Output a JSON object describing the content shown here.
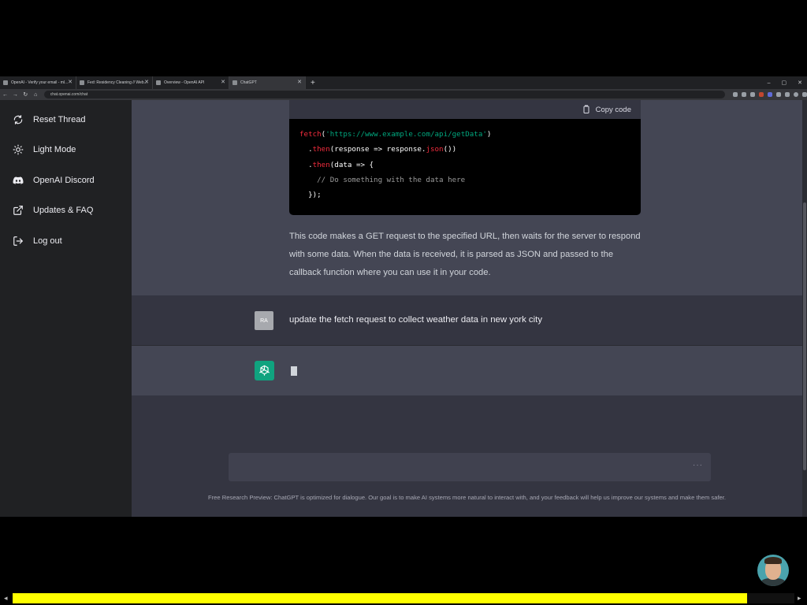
{
  "browser": {
    "tabs": [
      {
        "label": "OpenAI - Verify your email - ml..."
      },
      {
        "label": "Fed: Residency Cleaning // Web..."
      },
      {
        "label": "Overview - OpenAI API"
      },
      {
        "label": "ChatGPT"
      }
    ],
    "new_tab": "+",
    "url": "chat.openai.com/chat",
    "window_controls": {
      "minimize": "–",
      "maximize": "▢",
      "close": "✕"
    }
  },
  "sidebar": {
    "items": [
      {
        "label": "Reset Thread",
        "icon": "refresh-icon"
      },
      {
        "label": "Light Mode",
        "icon": "sun-icon"
      },
      {
        "label": "OpenAI Discord",
        "icon": "discord-icon"
      },
      {
        "label": "Updates & FAQ",
        "icon": "external-link-icon"
      },
      {
        "label": "Log out",
        "icon": "logout-icon"
      }
    ]
  },
  "conversation": {
    "code": {
      "copy_label": "Copy code",
      "lines": {
        "l1_fn": "fetch",
        "l1_open": "(",
        "l1_str": "'https://www.example.com/api/getData'",
        "l1_close": ")",
        "l2_dot": "  .",
        "l2_kw": "then",
        "l2_mid": "(response => response.",
        "l2_kw2": "json",
        "l2_end": "())",
        "l3_dot": "  .",
        "l3_kw": "then",
        "l3_end": "(data => {",
        "l4": "    // Do something with the data here",
        "l5": "  });"
      }
    },
    "explanation": "This code makes a GET request to the specified URL, then waits for the server to respond with some data. When the data is received, it is parsed as JSON and passed to the callback function where you can use it in your code.",
    "user": {
      "avatar_initials": "RA",
      "message": "update the fetch request to collect weather data in new york city"
    },
    "assistant": {
      "avatar_icon": "openai-logo-icon"
    }
  },
  "input": {
    "value": "",
    "send_indicator": "···"
  },
  "footer_note": "Free Research Preview: ChatGPT is optimized for dialogue. Our goal is to make AI systems more natural to interact with, and your feedback will help us improve our systems and make them safer.",
  "video_overlay": {
    "progress_fraction": 0.94
  }
}
